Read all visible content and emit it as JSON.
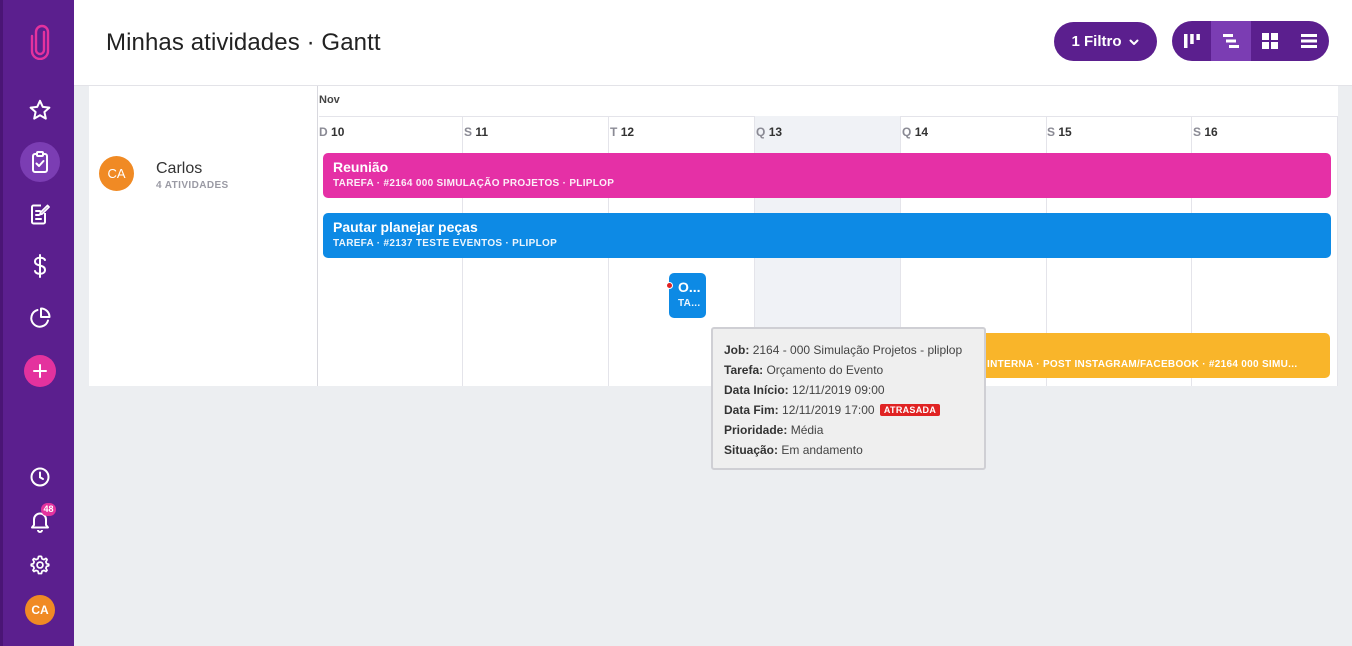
{
  "sidebar": {
    "items": [
      {
        "icon": "paperclip-logo-icon"
      },
      {
        "icon": "star-icon"
      },
      {
        "icon": "clipboard-check-icon",
        "active": true
      },
      {
        "icon": "edit-document-icon"
      },
      {
        "icon": "dollar-icon"
      },
      {
        "icon": "pie-chart-icon"
      },
      {
        "icon": "plus-icon"
      },
      {
        "icon": "clock-icon"
      },
      {
        "icon": "bell-icon"
      },
      {
        "icon": "gear-icon"
      }
    ],
    "notifications_count": "48",
    "user_initials": "CA"
  },
  "header": {
    "title": "Minhas atividades · Gantt",
    "filter_label": "1 Filtro",
    "views": [
      {
        "icon": "kanban-icon"
      },
      {
        "icon": "gantt-icon",
        "active": true
      },
      {
        "icon": "grid-icon"
      },
      {
        "icon": "list-icon"
      }
    ]
  },
  "gantt": {
    "person": {
      "initials": "CA",
      "name": "Carlos",
      "count": "4 ATIVIDADES"
    },
    "month": "Nov",
    "days": [
      {
        "dow": "D",
        "num": "10"
      },
      {
        "dow": "S",
        "num": "11"
      },
      {
        "dow": "T",
        "num": "12"
      },
      {
        "dow": "Q",
        "num": "13",
        "today": true
      },
      {
        "dow": "Q",
        "num": "14"
      },
      {
        "dow": "S",
        "num": "15"
      },
      {
        "dow": "S",
        "num": "16"
      }
    ],
    "tasks": [
      {
        "title": "Reunião",
        "meta": "TAREFA  ·  #2164 000 SIMULAÇÃO PROJETOS  ·  PLIPLOP",
        "color": "#e530a6"
      },
      {
        "title": "Pautar planejar peças",
        "meta": "TAREFA  ·  #2137 TESTE EVENTOS  ·  PLIPLOP",
        "color": "#0d8ae5"
      },
      {
        "title": "O...",
        "meta": "TA...",
        "color": "#0d8ae5"
      },
      {
        "title": "",
        "meta": "INTERNA  ·  POST INSTAGRAM/FACEBOOK  ·  #2164 000 SIMU...",
        "color": "#f9b52a"
      }
    ]
  },
  "tooltip": {
    "job_label": "Job:",
    "job_value": "2164 - 000 Simulação Projetos - pliplop",
    "task_label": "Tarefa:",
    "task_value": "Orçamento do Evento",
    "start_label": "Data Início:",
    "start_value": "12/11/2019 09:00",
    "end_label": "Data Fim:",
    "end_value": "12/11/2019 17:00",
    "late_tag": "ATRASADA",
    "priority_label": "Prioridade:",
    "priority_value": "Média",
    "status_label": "Situação:",
    "status_value": "Em andamento"
  }
}
